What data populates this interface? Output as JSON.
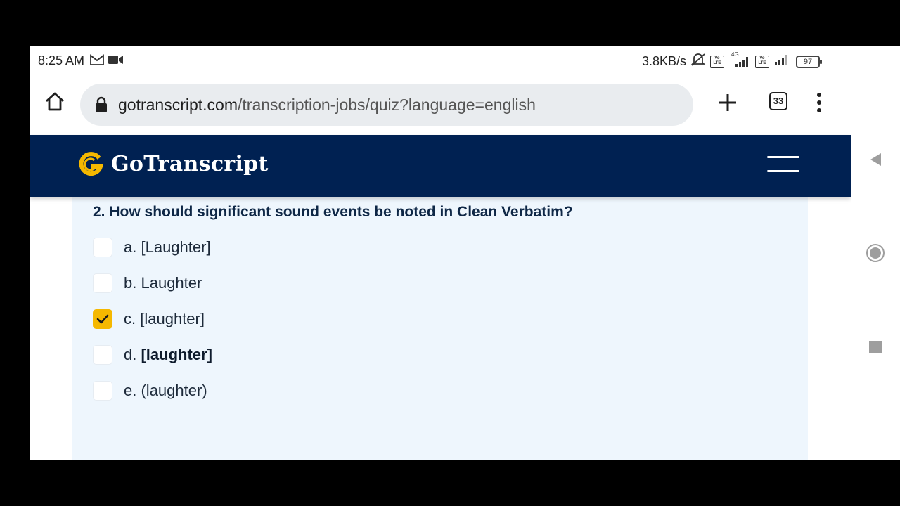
{
  "status_bar": {
    "time": "8:25 AM",
    "left_icons": [
      "gmail-icon",
      "video-camera-icon"
    ],
    "network_speed": "3.8KB/s",
    "right_icons": [
      "mute-icon",
      "volte-icon",
      "signal-4g-icon",
      "volte-icon",
      "signal-icon"
    ],
    "network_label": "4G",
    "volte_label": "Vo LTE",
    "battery": "97"
  },
  "browser": {
    "url_host": "gotranscript.com",
    "url_path": "/transcription-jobs/quiz?language=english",
    "tab_count": "33"
  },
  "site": {
    "brand": "GoTranscript",
    "brand_colors": {
      "navy": "#002152",
      "gold": "#f5b800"
    }
  },
  "quiz": {
    "question": "2. How should significant sound events be noted in Clean Verbatim?",
    "options": [
      {
        "letter": "a.",
        "text": "[Laughter]",
        "checked": false,
        "bold": false
      },
      {
        "letter": "b.",
        "text": "Laughter",
        "checked": false,
        "bold": false
      },
      {
        "letter": "c.",
        "text": "[laughter]",
        "checked": true,
        "bold": false
      },
      {
        "letter": "d.",
        "text": "[laughter]",
        "checked": false,
        "bold": true
      },
      {
        "letter": "e.",
        "text": "(laughter)",
        "checked": false,
        "bold": false
      }
    ]
  },
  "system_nav": [
    "back-icon",
    "home-circle-icon",
    "recents-square-icon"
  ]
}
